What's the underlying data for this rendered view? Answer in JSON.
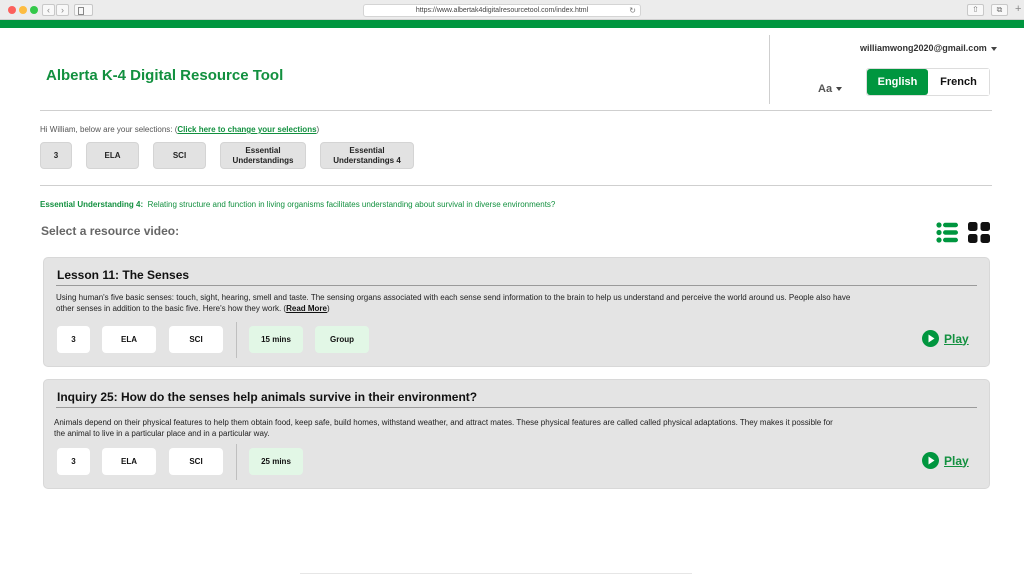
{
  "browser": {
    "url": "https://www.albertak4digitalresourcetool.com/index.html",
    "back": "‹",
    "forward": "›",
    "reload": "↻",
    "share": "⇧",
    "tabs": "⧉",
    "new_tab": "+"
  },
  "header": {
    "title": "Alberta K-4 Digital Resource Tool",
    "account_email": "williamwong2020@gmail.com",
    "font_size_label": "Aa",
    "languages": [
      {
        "label": "English",
        "active": true
      },
      {
        "label": "French",
        "active": false
      }
    ]
  },
  "selection": {
    "greeting_prefix": "Hi William, below are your selections: (",
    "change_link": "Click here to change your selections",
    "greeting_suffix": ")",
    "chips": [
      "3",
      "ELA",
      "SCI",
      "Essential Understandings",
      "Essential Understandings 4"
    ]
  },
  "essential_understanding": {
    "label": "Essential Understanding 4:",
    "text": "Relating structure and function in living organisms facilitates understanding about survival in diverse environments?"
  },
  "resources": {
    "heading": "Select a resource video:",
    "cards": [
      {
        "title": "Lesson 11: The Senses",
        "description": "Using human's five basic senses: touch, sight, hearing, smell and taste. The sensing organs associated with each sense send information to the brain to help us understand and perceive the world around us. People also have other senses in addition to the basic five. Here's how they work. (",
        "read_more": "Read More",
        "description_end": ")",
        "tags": [
          "3",
          "ELA",
          "SCI"
        ],
        "meta": [
          "15 mins",
          "Group"
        ],
        "play_label": "Play"
      },
      {
        "title": "Inquiry 25: How do the senses help animals survive in their environment?",
        "description": "Animals depend on their physical features to help them obtain food, keep safe, build homes, withstand weather, and attract mates. These physical features are called called physical adaptations. They makes it possible for the animal to live in a particular place and in a particular way.",
        "tags": [
          "3",
          "ELA",
          "SCI"
        ],
        "meta": [
          "25 mins"
        ],
        "play_label": "Play"
      }
    ]
  },
  "colors": {
    "brand_green": "#00963f",
    "text_green": "#12903f",
    "card_bg": "#e4e4e4",
    "meta_tag_bg": "#e2f7e6"
  },
  "icons": {
    "view_list": "list-view-icon",
    "view_grid": "grid-view-icon",
    "play": "play-circle-icon"
  }
}
